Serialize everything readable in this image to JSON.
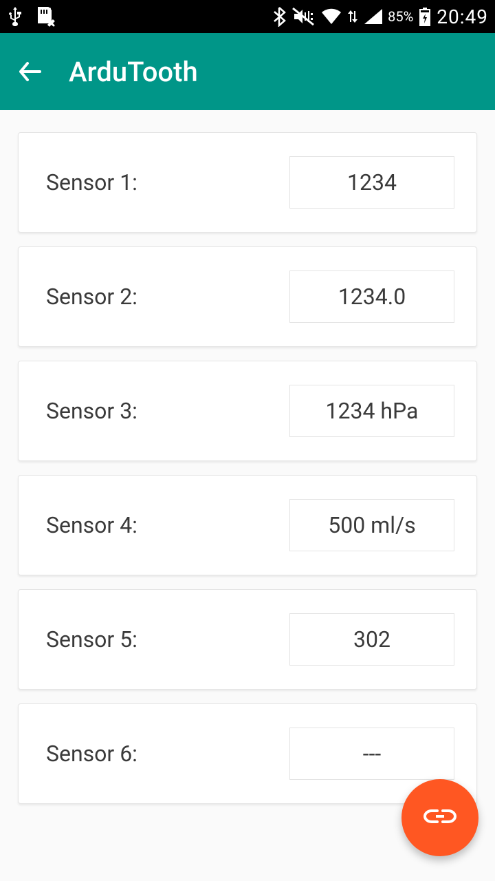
{
  "status": {
    "battery_pct": "85%",
    "time": "20:49"
  },
  "app": {
    "title": "ArduTooth"
  },
  "sensors": [
    {
      "label": "Sensor 1:",
      "value": "1234"
    },
    {
      "label": "Sensor 2:",
      "value": "1234.0"
    },
    {
      "label": "Sensor 3:",
      "value": "1234 hPa"
    },
    {
      "label": "Sensor 4:",
      "value": "500 ml/s"
    },
    {
      "label": "Sensor 5:",
      "value": "302"
    },
    {
      "label": "Sensor 6:",
      "value": "---"
    }
  ]
}
